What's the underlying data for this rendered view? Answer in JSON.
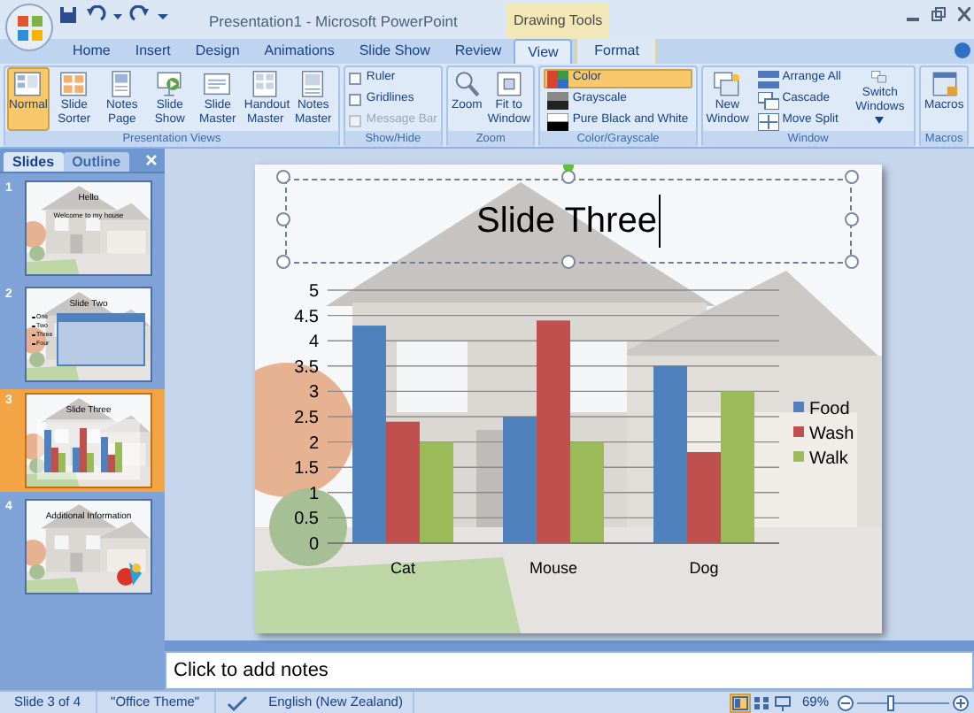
{
  "window": {
    "title": "Presentation1 - Microsoft PowerPoint",
    "contextual_tab": "Drawing Tools"
  },
  "tabs": [
    {
      "label": "Home",
      "selected": false,
      "kind": "main"
    },
    {
      "label": "Insert",
      "selected": false,
      "kind": "main"
    },
    {
      "label": "Design",
      "selected": false,
      "kind": "main"
    },
    {
      "label": "Animations",
      "selected": false,
      "kind": "main"
    },
    {
      "label": "Slide Show",
      "selected": false,
      "kind": "main"
    },
    {
      "label": "Review",
      "selected": false,
      "kind": "main"
    },
    {
      "label": "View",
      "selected": true,
      "kind": "main"
    },
    {
      "label": "Format",
      "selected": false,
      "kind": "contextual"
    }
  ],
  "ribbon_groups": [
    {
      "title": "Presentation Views",
      "items": [
        {
          "kind": "large",
          "label": "Normal",
          "selected": true
        },
        {
          "kind": "large",
          "label": "Slide Sorter",
          "selected": false
        },
        {
          "kind": "large",
          "label": "Notes Page",
          "selected": false
        },
        {
          "kind": "large",
          "label": "Slide Show",
          "selected": false
        },
        {
          "kind": "large",
          "label": "Slide Master",
          "selected": false
        },
        {
          "kind": "large",
          "label": "Handout Master",
          "selected": false
        },
        {
          "kind": "large",
          "label": "Notes Master",
          "selected": false
        }
      ]
    },
    {
      "title": "Show/Hide",
      "items": [
        {
          "kind": "check",
          "label": "Ruler",
          "checked": false,
          "disabled": false
        },
        {
          "kind": "check",
          "label": "Gridlines",
          "checked": false,
          "disabled": false
        },
        {
          "kind": "check",
          "label": "Message Bar",
          "checked": false,
          "disabled": true
        }
      ]
    },
    {
      "title": "Zoom",
      "items": [
        {
          "kind": "large",
          "label": "Zoom",
          "selected": false
        },
        {
          "kind": "large",
          "label": "Fit to Window",
          "selected": false
        }
      ]
    },
    {
      "title": "Color/Grayscale",
      "items": [
        {
          "kind": "small",
          "label": "Color",
          "selected": true
        },
        {
          "kind": "small",
          "label": "Grayscale",
          "selected": false
        },
        {
          "kind": "small",
          "label": "Pure Black and White",
          "selected": false
        }
      ]
    },
    {
      "title": "Window",
      "items": [
        {
          "kind": "large",
          "label": "New Window",
          "selected": false
        },
        {
          "kind": "small",
          "label": "Arrange All",
          "selected": false
        },
        {
          "kind": "small",
          "label": "Cascade",
          "selected": false
        },
        {
          "kind": "small",
          "label": "Move Split",
          "selected": false
        },
        {
          "kind": "large",
          "label": "Switch Windows",
          "selected": false,
          "has_menu": true
        }
      ]
    },
    {
      "title": "Macros",
      "items": [
        {
          "kind": "large",
          "label": "Macros",
          "selected": false
        }
      ]
    }
  ],
  "pane_tabs": [
    {
      "label": "Slides",
      "selected": true
    },
    {
      "label": "Outline",
      "selected": false
    }
  ],
  "slides": [
    {
      "number": "1",
      "selected": false,
      "kind": "title",
      "title": "Hello",
      "subtitle": "Welcome to my house"
    },
    {
      "number": "2",
      "selected": false,
      "kind": "table",
      "title": "Slide Two",
      "bullets": [
        "One",
        "Two",
        "Three",
        "Four"
      ]
    },
    {
      "number": "3",
      "selected": true,
      "kind": "chart",
      "title": "Slide Three"
    },
    {
      "number": "4",
      "selected": false,
      "kind": "clipart",
      "title": "Additional Information"
    }
  ],
  "slide": {
    "title": "Slide Three",
    "chart_data": {
      "type": "bar",
      "categories": [
        "Cat",
        "Mouse",
        "Dog"
      ],
      "series": [
        {
          "name": "Food",
          "color": "#4f81bd",
          "values": [
            4.3,
            2.5,
            3.5
          ]
        },
        {
          "name": "Wash",
          "color": "#c0504d",
          "values": [
            2.4,
            4.4,
            1.8
          ]
        },
        {
          "name": "Walk",
          "color": "#9bbb59",
          "values": [
            2,
            2,
            3
          ]
        }
      ],
      "ylim": [
        0,
        5
      ],
      "yticks": [
        0,
        0.5,
        1,
        1.5,
        2,
        2.5,
        3,
        3.5,
        4,
        4.5,
        5
      ],
      "grid": true,
      "legend": true
    }
  },
  "notes": {
    "placeholder": "Click to add notes"
  },
  "status_bar": {
    "slide": "Slide 3 of 4",
    "theme": "\"Office Theme\"",
    "language": "English (New Zealand)",
    "zoom": "69%",
    "zoom_slider": {
      "level": 0.35
    },
    "views": [
      {
        "selected": true
      },
      {
        "selected": false
      },
      {
        "selected": false
      }
    ]
  }
}
